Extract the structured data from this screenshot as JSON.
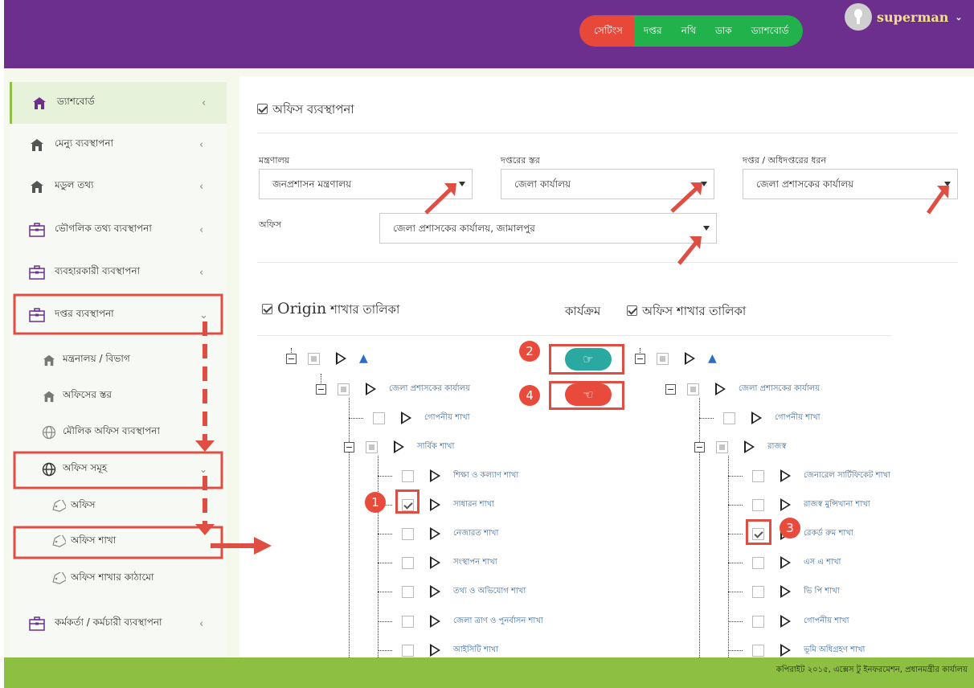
{
  "header": {
    "nav": [
      "সেটিংস",
      "দপ্তর",
      "নথি",
      "ডাক",
      "ড্যাশবোর্ড"
    ],
    "user": "superman"
  },
  "sidebar": {
    "items": [
      {
        "label": "ড্যাশবোর্ড",
        "icon": "home-icon"
      },
      {
        "label": "মেন্যু ব্যবস্থাপনা",
        "icon": "home-icon"
      },
      {
        "label": "মডুল তথ্য",
        "icon": "home-icon"
      },
      {
        "label": "ভৌগলিক তথ্য ব্যবস্থাপনা",
        "icon": "briefcase-icon"
      },
      {
        "label": "ব্যবহারকারী ব্যবস্থাপনা",
        "icon": "briefcase-icon"
      },
      {
        "label": "দপ্তর ব্যবস্থাপনা",
        "icon": "briefcase-icon"
      },
      {
        "label": "মন্ত্রনালয় / বিভাগ",
        "icon": "home-icon"
      },
      {
        "label": "অফিসের স্তর",
        "icon": "home-icon"
      },
      {
        "label": "মৌলিক অফিস ব্যবস্থাপনা",
        "icon": "globe-icon"
      },
      {
        "label": "অফিস সমূহ",
        "icon": "globe-icon"
      },
      {
        "label": "অফিস",
        "icon": "tag-icon"
      },
      {
        "label": "অফিস শাখা",
        "icon": "tag-icon"
      },
      {
        "label": "অফিস শাখার কাঠামো",
        "icon": "tag-icon"
      },
      {
        "label": "কর্মকর্তা / কর্মচারী ব্যবস্থাপনা",
        "icon": "briefcase-icon"
      }
    ]
  },
  "main": {
    "title": "অফিস ব্যবস্থাপনা",
    "fields": {
      "ministry_label": "মন্ত্রণালয়",
      "ministry_value": "জনপ্রশাসন মন্ত্রণালয়",
      "layer_label": "দপ্তরের স্তর",
      "layer_value": "জেলা কার্যালয়",
      "type_label": "দপ্তর / অধিদপ্তরের ধরন",
      "type_value": "জেলা প্রশাসকের কার্যালয়",
      "office_label": "অফিস",
      "office_value": "জেলা প্রশাসকের কার্যালয়, জামালপুর"
    },
    "origin_title_en": "Origin",
    "origin_title_bn": "শাখার তালিকা",
    "action_title": "কার্যক্রম",
    "office_branch_title": "অফিস শাখার তালিকা",
    "left_tree": {
      "root": "জেলা প্রশাসকের কার্যালয়",
      "items": [
        "গোপনীয় শাখা",
        "সার্বিক শাখা",
        "শিক্ষা ও কল্যাণ শাখা",
        "সাধারন শাখা",
        "নেজারত শাখা",
        "সংস্থাপন শাখা",
        "তথ্য ও অভিযোগ শাখা",
        "জেলা ত্রাণ ও পুনর্বাসন শাখা",
        "আইসিটি শাখা"
      ]
    },
    "right_tree": {
      "root": "জেলা প্রশাসকের কার্যালয়",
      "items": [
        "গোপনীয় শাখা",
        "রাজস্ব",
        "জেনারেল সার্টিফিকেট শাখা",
        "রাজস্ব মুন্সিখানা শাখা",
        "রেকর্ড রুম শাখা",
        "এস এ শাখা",
        "ভি পি শাখা",
        "গোপনীয় শাখা",
        "ভূমি অধিগ্রহণ শাখা"
      ]
    },
    "badges": [
      "1",
      "2",
      "3",
      "4"
    ],
    "colors": {
      "add_button": "#2aa9a0",
      "remove_button": "#e84b3c"
    }
  },
  "footer": {
    "text": "কপিরাইট ২০১৫, এক্সেস টু ইনফরমেশন, প্রধানমন্ত্রীর কার্যালয়"
  }
}
